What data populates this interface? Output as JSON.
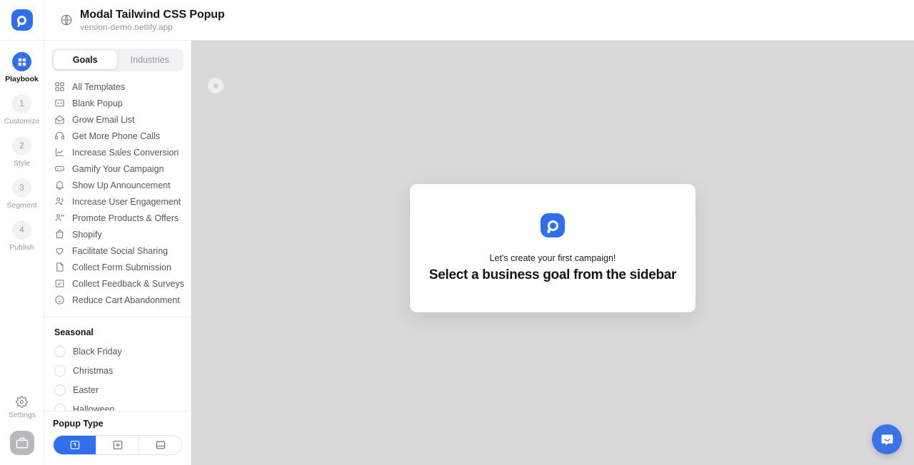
{
  "header": {
    "title": "Modal Tailwind CSS Popup",
    "url": "version-demo.netlify.app",
    "globe_icon": "globe-icon",
    "logo_icon": "popupsmart-logo"
  },
  "rail": {
    "items": [
      {
        "badge": "",
        "label": "Playbook",
        "active": true,
        "icon": "grid-icon"
      },
      {
        "badge": "1",
        "label": "Customize",
        "active": false
      },
      {
        "badge": "2",
        "label": "Style",
        "active": false
      },
      {
        "badge": "3",
        "label": "Segment",
        "active": false
      },
      {
        "badge": "4",
        "label": "Publish",
        "active": false
      }
    ],
    "settings_label": "Settings",
    "settings_icon": "gear-icon",
    "avatar_icon": "briefcase-icon"
  },
  "panel": {
    "tabs": [
      {
        "label": "Goals",
        "active": true
      },
      {
        "label": "Industries",
        "active": false
      }
    ],
    "goals": [
      {
        "label": "All Templates",
        "icon": "grid-icon"
      },
      {
        "label": "Blank Popup",
        "icon": "blank-popup-icon"
      },
      {
        "label": "Grow Email List",
        "icon": "envelope-icon"
      },
      {
        "label": "Get More Phone Calls",
        "icon": "headset-icon"
      },
      {
        "label": "Increase Sales Conversion",
        "icon": "chart-line-icon"
      },
      {
        "label": "Gamify Your Campaign",
        "icon": "gamepad-icon"
      },
      {
        "label": "Show Up Announcement",
        "icon": "bell-icon"
      },
      {
        "label": "Increase User Engagement",
        "icon": "users-icon"
      },
      {
        "label": "Promote Products & Offers",
        "icon": "user-megaphone-icon"
      },
      {
        "label": "Shopify",
        "icon": "shopping-bag-icon"
      },
      {
        "label": "Facilitate Social Sharing",
        "icon": "heart-icon"
      },
      {
        "label": "Collect Form Submission",
        "icon": "clipboard-icon"
      },
      {
        "label": "Collect Feedback & Surveys",
        "icon": "checkbox-square-icon"
      },
      {
        "label": "Reduce Cart Abandonment",
        "icon": "sad-face-icon"
      }
    ],
    "seasonal_title": "Seasonal",
    "seasonal": [
      {
        "label": "Black Friday"
      },
      {
        "label": "Christmas"
      },
      {
        "label": "Easter"
      },
      {
        "label": "Halloween"
      }
    ],
    "popup_type_title": "Popup Type",
    "popup_types": [
      {
        "icon": "modal-popup-icon",
        "active": true
      },
      {
        "icon": "fullscreen-popup-icon",
        "active": false
      },
      {
        "icon": "bottom-bar-popup-icon",
        "active": false
      }
    ]
  },
  "canvas": {
    "modal": {
      "logo_icon": "popupsmart-logo",
      "subtitle": "Let's create your first campaign!",
      "title": "Select a business goal from the sidebar"
    },
    "chat_icon": "chat-bubble-icon",
    "handle_icon": "drag-handle-icon",
    "collapse_icon": "collapse-arrow-icon"
  },
  "colors": {
    "accent": "#2f6fed",
    "canvas": "#d9d9d9",
    "chat": "#3c72e8"
  }
}
